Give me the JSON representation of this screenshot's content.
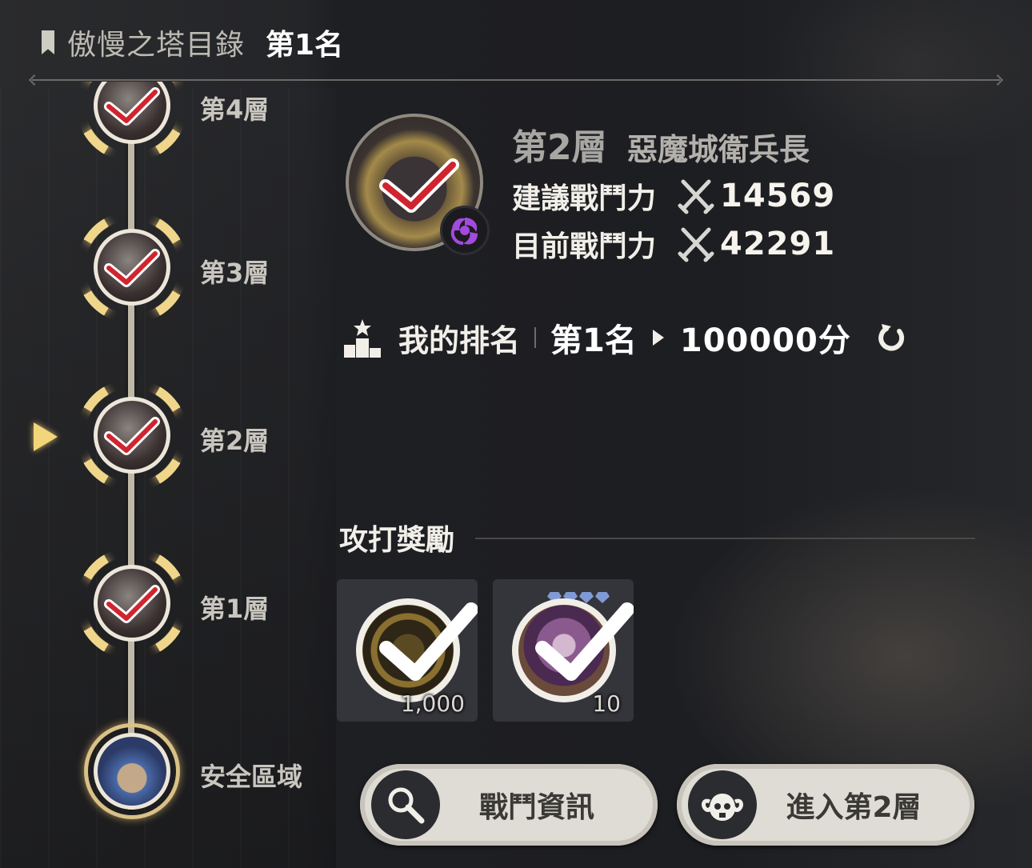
{
  "header": {
    "tower_title": "傲慢之塔目錄",
    "rank_text": "第1名"
  },
  "floors": [
    {
      "label": "第4層",
      "cleared": true,
      "current": false
    },
    {
      "label": "第3層",
      "cleared": true,
      "current": false
    },
    {
      "label": "第2層",
      "cleared": true,
      "current": true
    },
    {
      "label": "第1層",
      "cleared": true,
      "current": false
    },
    {
      "label": "安全區域",
      "cleared": false,
      "current": false
    }
  ],
  "boss": {
    "floor": "第2層",
    "name": "惡魔城衛兵長",
    "recommended_label": "建議戰鬥力",
    "recommended_value": "14569",
    "current_label": "目前戰鬥力",
    "current_value": "42291",
    "element_icon": "dark-swirl-icon"
  },
  "ranking": {
    "label": "我的排名",
    "rank": "第1名",
    "score": "100000分"
  },
  "rewards": {
    "title": "攻打獎勵",
    "items": [
      {
        "icon": "gold-medallion-icon",
        "quantity": "1,000",
        "claimed": true
      },
      {
        "icon": "crystal-gem-icon",
        "quantity": "10",
        "claimed": true
      }
    ]
  },
  "buttons": {
    "battle_info": "戰鬥資訊",
    "enter_floor": "進入第2層"
  },
  "colors": {
    "highlight_gold": "#f0d68a",
    "check_red": "#d0242e",
    "button_bg": "#dfdcd5",
    "element_purple": "#a24bdc"
  }
}
